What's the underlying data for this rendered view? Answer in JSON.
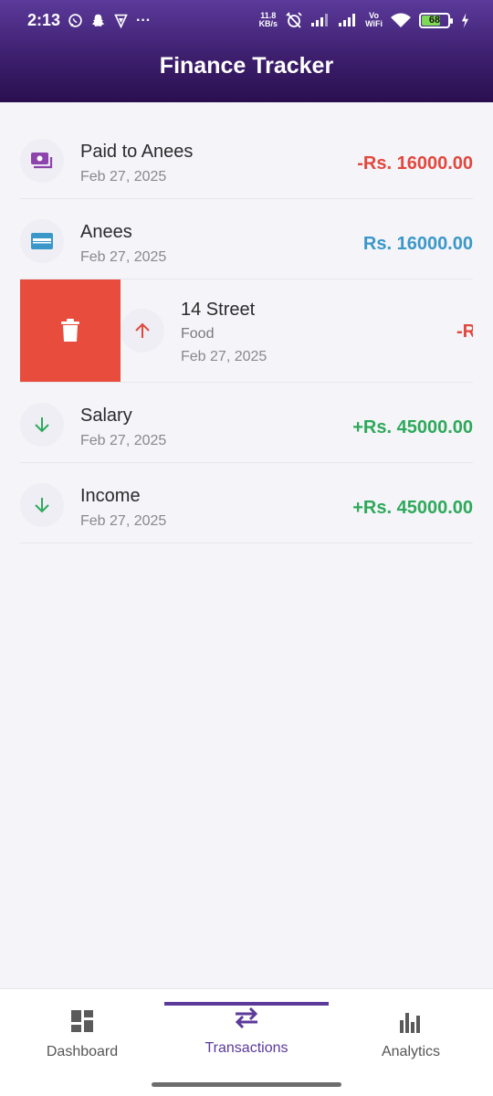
{
  "status_bar": {
    "time": "2:13",
    "dots": "···",
    "net_speed_value": "11.8",
    "net_speed_unit": "KB/s",
    "vowifi_top": "Vo",
    "vowifi_bottom": "WiFi",
    "battery": "68"
  },
  "header": {
    "title": "Finance Tracker"
  },
  "transactions": [
    {
      "title": "Paid to Anees",
      "date": "Feb 27, 2025",
      "amount": "-Rs. 16000.00",
      "icon": "cash-icon",
      "color": "#e2483d"
    },
    {
      "title": "Anees",
      "date": "Feb 27, 2025",
      "amount": "Rs. 16000.00",
      "icon": "credit-card-icon",
      "color": "#3a97c9"
    },
    {
      "title": "14 Street",
      "category": "Food",
      "date": "Feb 27, 2025",
      "amount": "-R",
      "icon": "arrow-up-icon",
      "color": "#e2483d",
      "swiped": true
    },
    {
      "title": "Salary",
      "date": "Feb 27, 2025",
      "amount": "+Rs. 45000.00",
      "icon": "arrow-down-icon",
      "color": "#2ea95a"
    },
    {
      "title": "Income",
      "date": "Feb 27, 2025",
      "amount": "+Rs. 45000.00",
      "icon": "arrow-down-icon",
      "color": "#2ea95a"
    }
  ],
  "bottom_nav": {
    "items": [
      {
        "label": "Dashboard",
        "icon": "dashboard-icon"
      },
      {
        "label": "Transactions",
        "icon": "swap-arrows-icon",
        "active": true
      },
      {
        "label": "Analytics",
        "icon": "bar-chart-icon"
      }
    ]
  },
  "colors": {
    "accent": "#5b3a9a",
    "delete": "#e74c3c"
  }
}
